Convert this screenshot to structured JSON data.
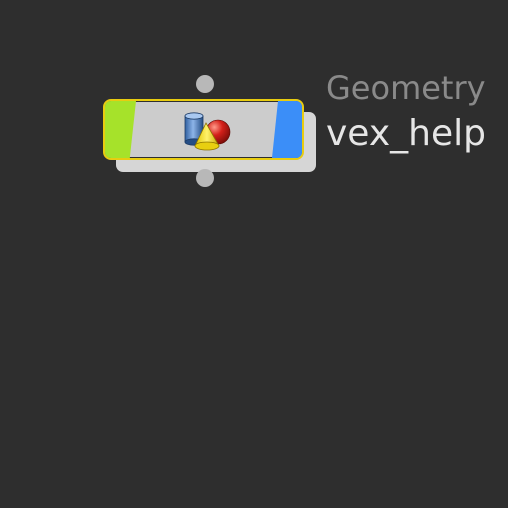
{
  "node": {
    "type_label": "Geometry",
    "name": "vex_help",
    "icon": "geometry-shapes-icon",
    "colors": {
      "display_flag": "#a6e22a",
      "bypass_flag": "#3b8ef8",
      "selection_outline": "#e8cc10",
      "body": "#cccccc"
    }
  },
  "canvas": {
    "background": "#2e2e2e"
  }
}
